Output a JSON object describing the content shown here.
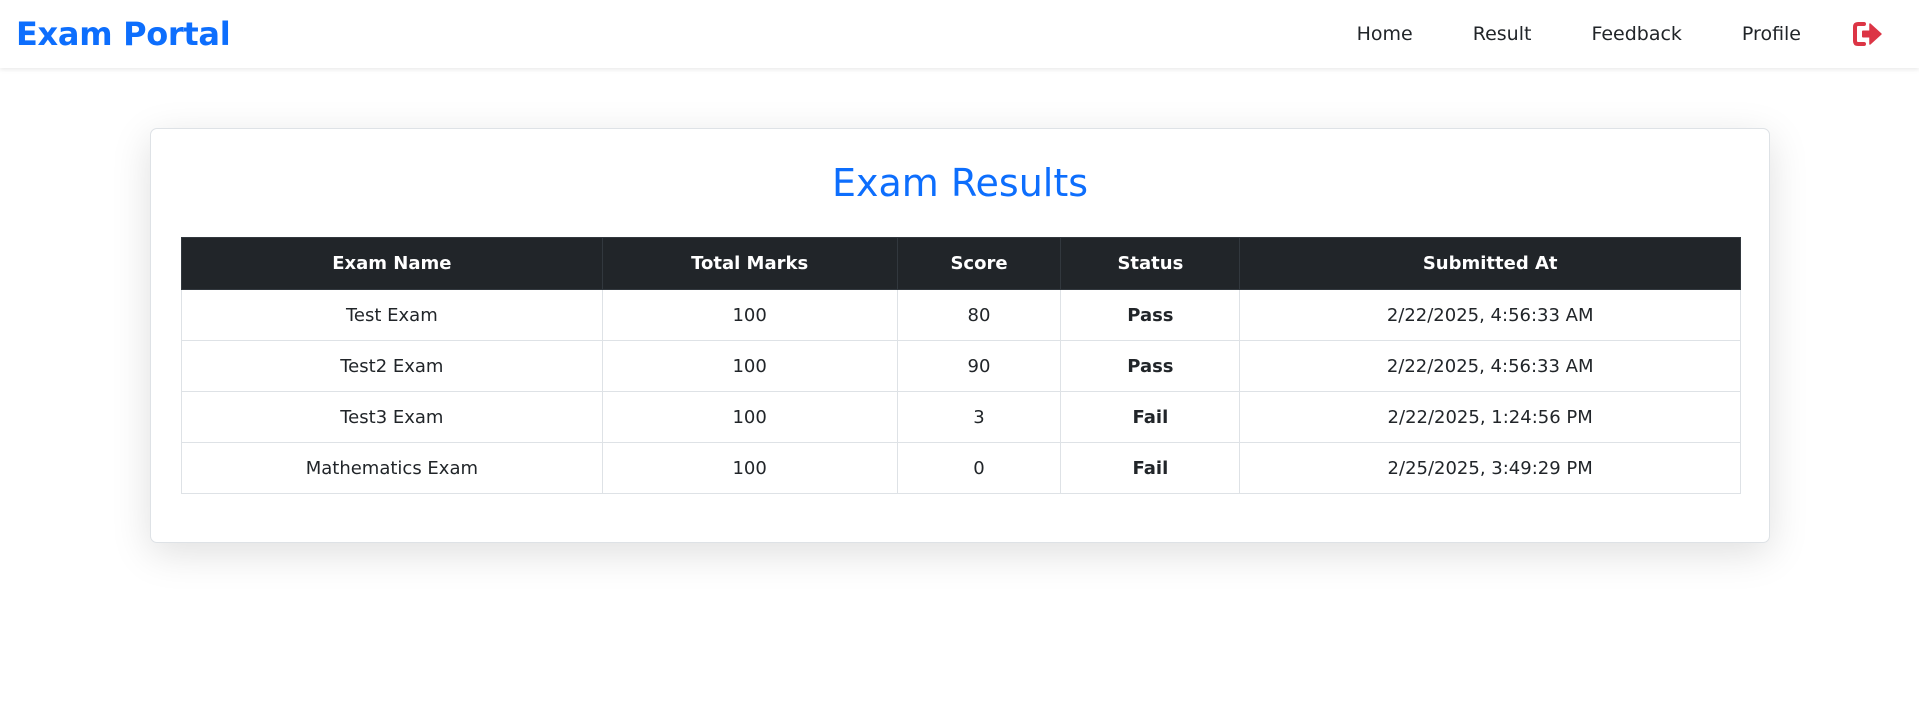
{
  "navbar": {
    "brand": "Exam Portal",
    "links": [
      {
        "label": "Home"
      },
      {
        "label": "Result"
      },
      {
        "label": "Feedback"
      },
      {
        "label": "Profile"
      }
    ],
    "logout_icon": "sign-out-icon"
  },
  "page": {
    "title": "Exam Results"
  },
  "table": {
    "columns": [
      "Exam Name",
      "Total Marks",
      "Score",
      "Status",
      "Submitted At"
    ],
    "rows": [
      {
        "exam_name": "Test Exam",
        "total_marks": "100",
        "score": "80",
        "status": "Pass",
        "submitted_at": "2/22/2025, 4:56:33 AM"
      },
      {
        "exam_name": "Test2 Exam",
        "total_marks": "100",
        "score": "90",
        "status": "Pass",
        "submitted_at": "2/22/2025, 4:56:33 AM"
      },
      {
        "exam_name": "Test3 Exam",
        "total_marks": "100",
        "score": "3",
        "status": "Fail",
        "submitted_at": "2/22/2025, 1:24:56 PM"
      },
      {
        "exam_name": "Mathematics Exam",
        "total_marks": "100",
        "score": "0",
        "status": "Fail",
        "submitted_at": "2/25/2025, 3:49:29 PM"
      }
    ]
  },
  "colors": {
    "brand": "#0d6efd",
    "pass": "#198754",
    "fail": "#dc3545",
    "table_header": "#212529"
  }
}
